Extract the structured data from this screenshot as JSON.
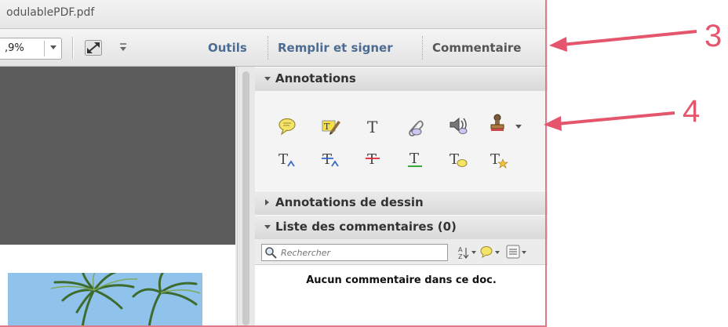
{
  "window": {
    "title": "odulablePDF.pdf"
  },
  "toolbar": {
    "zoom_value": ",9%",
    "tools_label": "Outils",
    "fill_sign_label": "Remplir et signer",
    "comment_label": "Commentaire"
  },
  "panel": {
    "annotations_label": "Annotations",
    "drawing_label": "Annotations de dessin",
    "comment_list_label": "Liste des commentaires (0)",
    "search_placeholder": "Rechercher",
    "no_comment_text": "Aucun commentaire dans ce doc.",
    "annotation_tools_row1": [
      "sticky-note-icon",
      "highlight-text-icon",
      "add-text-icon",
      "attach-file-icon",
      "record-audio-icon",
      "stamp-icon"
    ],
    "annotation_tools_row2": [
      "insert-text-icon",
      "replace-text-icon",
      "strikethrough-icon",
      "underline-icon",
      "text-comment-icon",
      "text-insert-star-icon"
    ]
  },
  "callouts": {
    "first": "3",
    "second": "4",
    "color": "#e5566c"
  }
}
